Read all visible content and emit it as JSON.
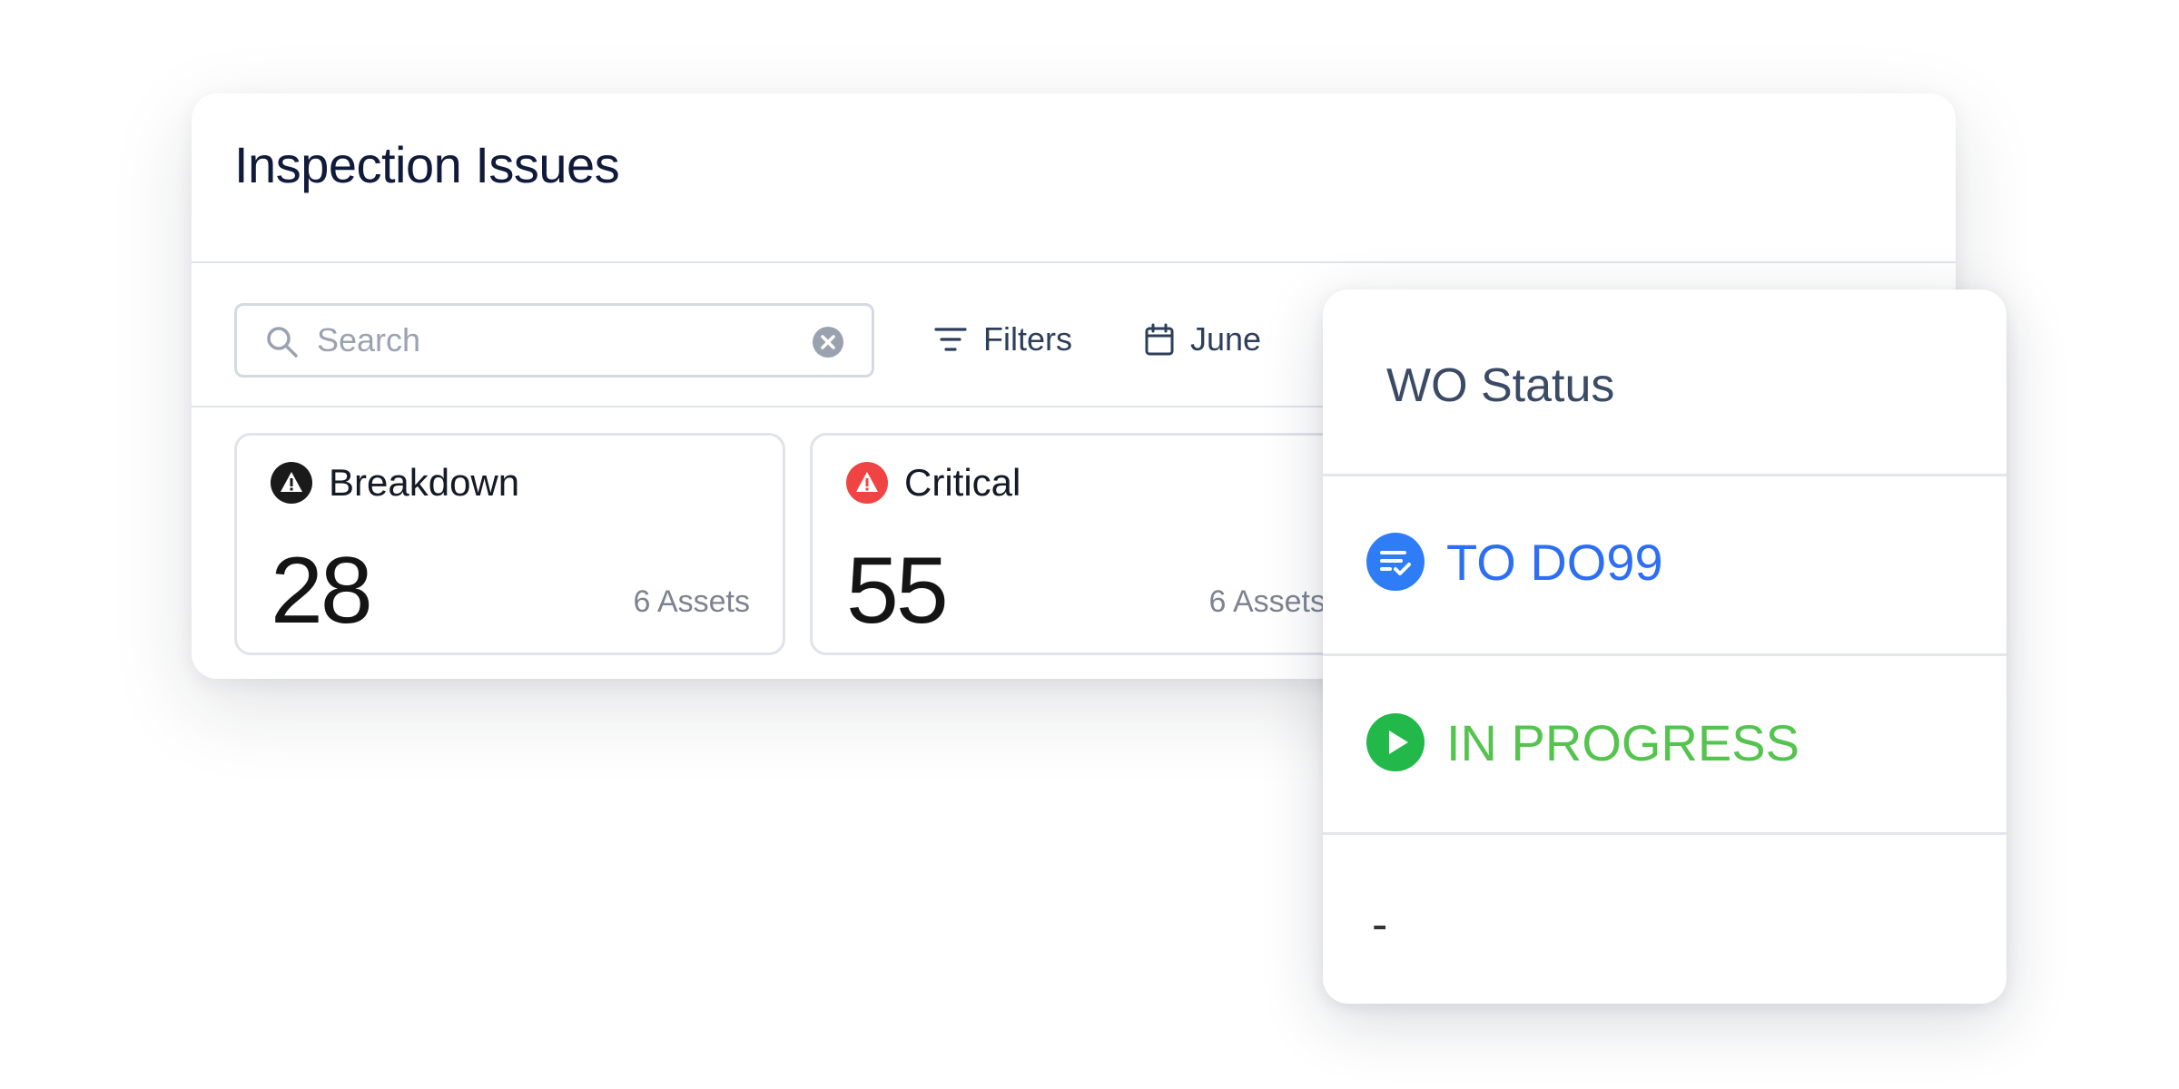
{
  "card": {
    "title": "Inspection Issues",
    "search": {
      "placeholder": "Search",
      "value": ""
    },
    "filters_label": "Filters",
    "date_label": "June",
    "stats": [
      {
        "label": "Breakdown",
        "value": "28",
        "assets": "6 Assets",
        "icon": "warning-icon",
        "icon_color": "#1a1a1a"
      },
      {
        "label": "Critical",
        "value": "55",
        "assets": "6 Assets",
        "icon": "warning-icon",
        "icon_color": "#f04444"
      }
    ]
  },
  "wo_status": {
    "title": "WO Status",
    "options": [
      {
        "label": "TO DO99",
        "icon": "checklist-icon",
        "color": "#2e6ef5"
      },
      {
        "label": "IN PROGRESS",
        "icon": "play-icon",
        "color": "#54c44e"
      },
      {
        "label": "-"
      }
    ]
  },
  "colors": {
    "title": "#101a3a",
    "todo_blue": "#2e6ef5",
    "progress_green": "#22b84a",
    "critical_red": "#f04444"
  }
}
